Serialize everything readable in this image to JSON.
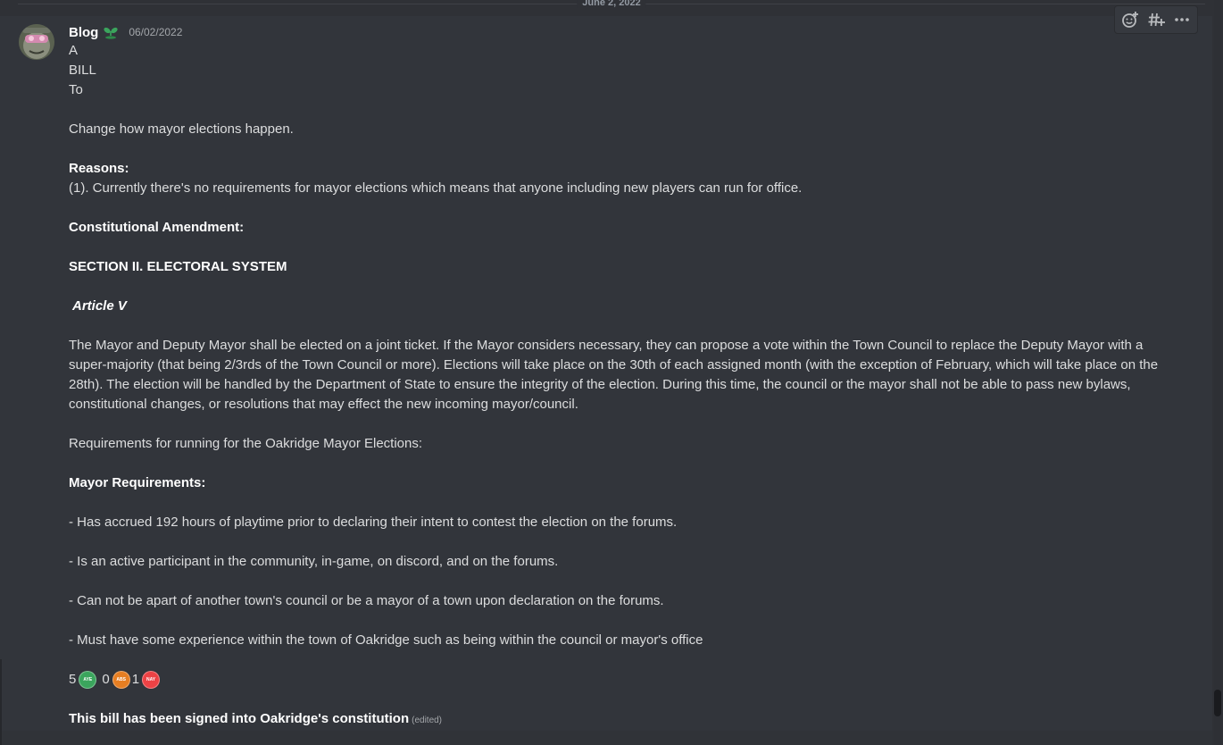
{
  "divider": {
    "date": "June 2, 2022"
  },
  "message": {
    "author": "Blog",
    "role_icon": "sprout-icon",
    "timestamp": "06/02/2022",
    "lines": {
      "l1": "A",
      "l2": "BILL",
      "l3": "To",
      "l4": "Change how mayor elections happen.",
      "reasons_heading": "Reasons:",
      "reason_1": "(1). Currently there's no requirements for mayor elections which means that anyone including new players can run for office.",
      "amendment_heading": "Constitutional Amendment:",
      "section_heading": "SECTION II. ELECTORAL SYSTEM",
      "article_heading": "Article V",
      "article_text": "The Mayor and Deputy Mayor shall be elected on a joint ticket. If the Mayor considers necessary, they can propose a vote within the Town Council to replace the Deputy Mayor with a super-majority (that being 2/3rds of the Town Council or more). Elections will take place on the 30th of each assigned month (with the exception of February, which will take place on the 28th). The election will be handled by the Department of State to ensure the integrity of the election. During this time, the council or the mayor shall not be able to pass new bylaws, constitutional changes, or resolutions that may effect the new incoming mayor/council.",
      "requirements_intro": "Requirements for running for the Oakridge Mayor Elections:",
      "mayor_req_heading": "Mayor Requirements:",
      "req_1": "- Has accrued 192 hours of playtime prior to declaring their intent to contest the election on the forums.",
      "req_2": "- Is an active participant in the community, in-game, on discord, and on the forums.",
      "req_3": "- Can not be apart of another town's council or be a mayor of a town upon declaration on the forums.",
      "req_4": "- Must have some experience within the town of Oakridge such as being within the council or mayor's office",
      "final": "This bill has been signed into Oakridge's constitution",
      "edited": "(edited)"
    },
    "votes": [
      {
        "count": "5",
        "label": "AYE",
        "color": "#3ba55d"
      },
      {
        "count": "0",
        "label": "ABS",
        "color": "#e67e22"
      },
      {
        "count": "1",
        "label": "NAY",
        "color": "#ed4245"
      }
    ]
  },
  "toolbar": {
    "add_reaction_icon": "add-reaction-icon",
    "create_thread_icon": "create-thread-icon",
    "more_icon": "more-icon"
  }
}
